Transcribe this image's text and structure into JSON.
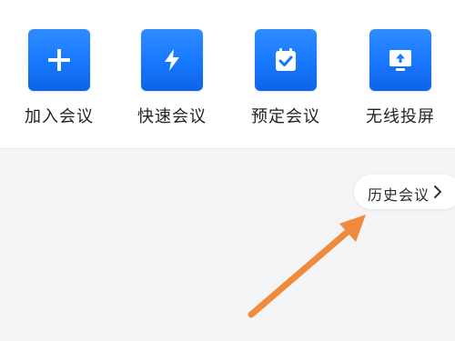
{
  "quick_actions": [
    {
      "label": "加入会议",
      "icon": "plus-icon"
    },
    {
      "label": "快速会议",
      "icon": "lightning-icon"
    },
    {
      "label": "预定会议",
      "icon": "calendar-check-icon"
    },
    {
      "label": "无线投屏",
      "icon": "screen-cast-icon"
    }
  ],
  "history": {
    "label": "历史会议",
    "icon": "chevron-right-icon"
  },
  "colors": {
    "tile_blue": "#1677ff",
    "annotation_orange": "#f08a3c",
    "background": "#f5f5f7"
  }
}
